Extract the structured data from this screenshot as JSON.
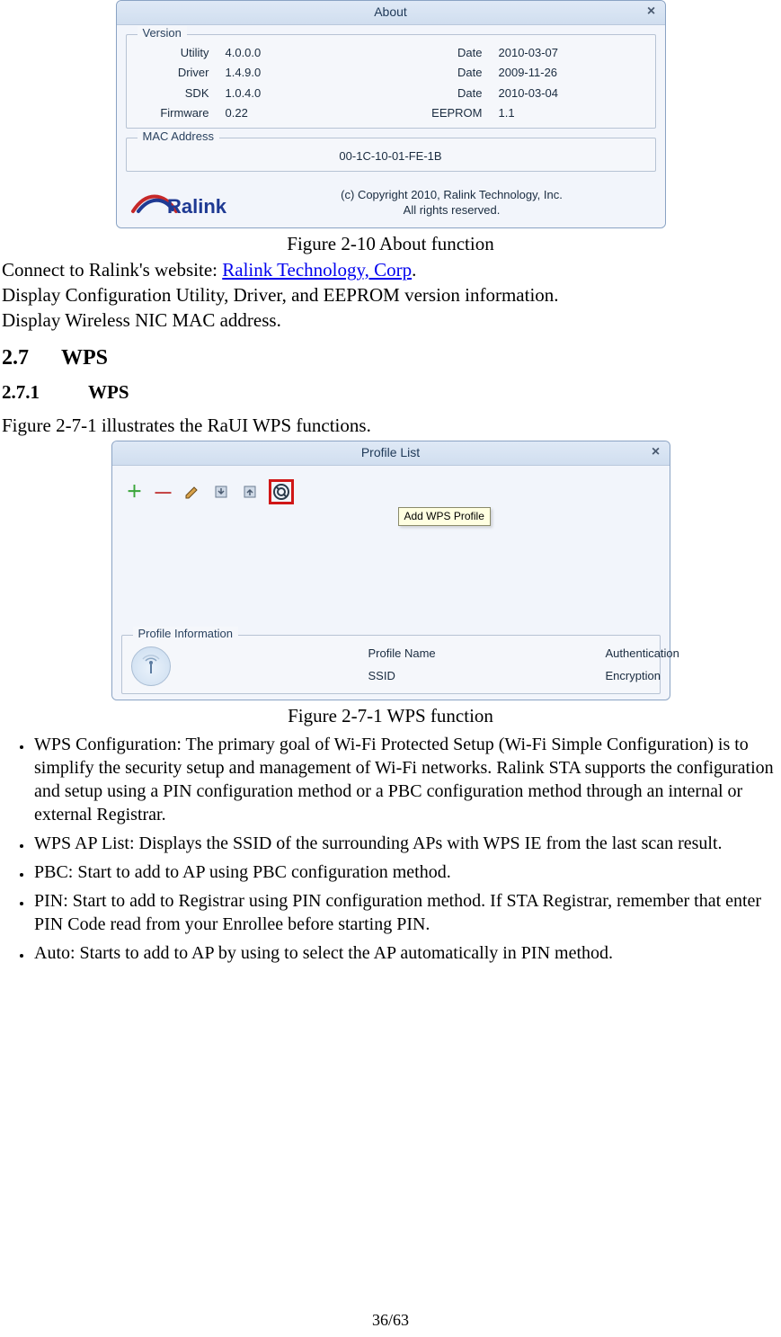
{
  "about_window": {
    "title": "About",
    "version": {
      "legend": "Version",
      "rows": [
        {
          "labelL": "Utility",
          "valueL": "4.0.0.0",
          "labelR": "Date",
          "valueR": "2010-03-07"
        },
        {
          "labelL": "Driver",
          "valueL": "1.4.9.0",
          "labelR": "Date",
          "valueR": "2009-11-26"
        },
        {
          "labelL": "SDK",
          "valueL": "1.0.4.0",
          "labelR": "Date",
          "valueR": "2010-03-04"
        },
        {
          "labelL": "Firmware",
          "valueL": "0.22",
          "labelR": "EEPROM",
          "valueR": "1.1"
        }
      ]
    },
    "mac": {
      "legend": "MAC Address",
      "value": "00-1C-10-01-FE-1B"
    },
    "copyright_line1": "(c) Copyright 2010, Ralink Technology, Inc.",
    "copyright_line2": "All rights reserved.",
    "logo_text": "Ralink"
  },
  "fig1_caption": "Figure 2-10 About function",
  "intro": {
    "p1_prefix": "Connect to Ralink's website: ",
    "p1_link": "Ralink Technology, Corp",
    "p1_suffix": ".",
    "p2": "Display Configuration Utility, Driver, and EEPROM version information.",
    "p3": "Display Wireless NIC MAC address."
  },
  "section": {
    "num": "2.7",
    "title": "WPS"
  },
  "subsection": {
    "num": "2.7.1",
    "title": "WPS"
  },
  "lead": "Figure 2-7-1 illustrates the RaUI WPS functions.",
  "wps_window": {
    "title": "Profile List",
    "tooltip": "Add WPS Profile",
    "profile_info": {
      "legend": "Profile Information",
      "l1": "Profile Name",
      "r1": "Authentication",
      "l2": "SSID",
      "r2": "Encryption"
    }
  },
  "fig2_caption": "Figure 2-7-1 WPS function",
  "bullets": [
    "WPS Configuration: The primary goal of Wi-Fi Protected Setup (Wi-Fi Simple Configuration) is to simplify the security setup and management of Wi-Fi networks. Ralink STA supports the configuration and setup using a PIN configuration method or a PBC configuration method through an internal or external Registrar.",
    "WPS AP List: Displays the SSID of the surrounding APs with WPS IE from the last scan result.",
    "PBC: Start to add to AP using PBC configuration method.",
    "PIN: Start to add to Registrar using PIN configuration method. If STA Registrar, remember that enter PIN Code read from your Enrollee before starting PIN.",
    "Auto: Starts to add to AP by using to select the AP automatically in PIN method."
  ],
  "page_number": "36/63"
}
